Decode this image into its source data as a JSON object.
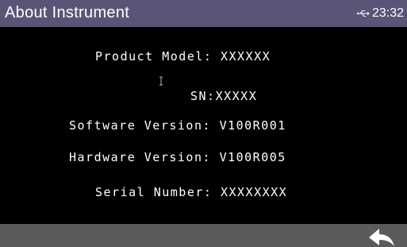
{
  "header": {
    "title": "About Instrument",
    "time": "23:32",
    "usb_icon": "usb-icon"
  },
  "info": {
    "product_model_label": "Product Model:",
    "product_model_value": "XXXXXX",
    "sn_label": "SN:",
    "sn_value": "XXXXX",
    "software_version_label": "Software Version:",
    "software_version_value": "V100R001",
    "hardware_version_label": "Hardware Version:",
    "hardware_version_value": "V100R005",
    "serial_number_label": "Serial Number:",
    "serial_number_value": "XXXXXXXX"
  },
  "footer": {
    "back_icon": "back-arrow-icon"
  },
  "colors": {
    "title_bar": "#5c5477",
    "background": "#000000",
    "footer_bar": "#5b5b5b",
    "text": "#ffffff"
  }
}
